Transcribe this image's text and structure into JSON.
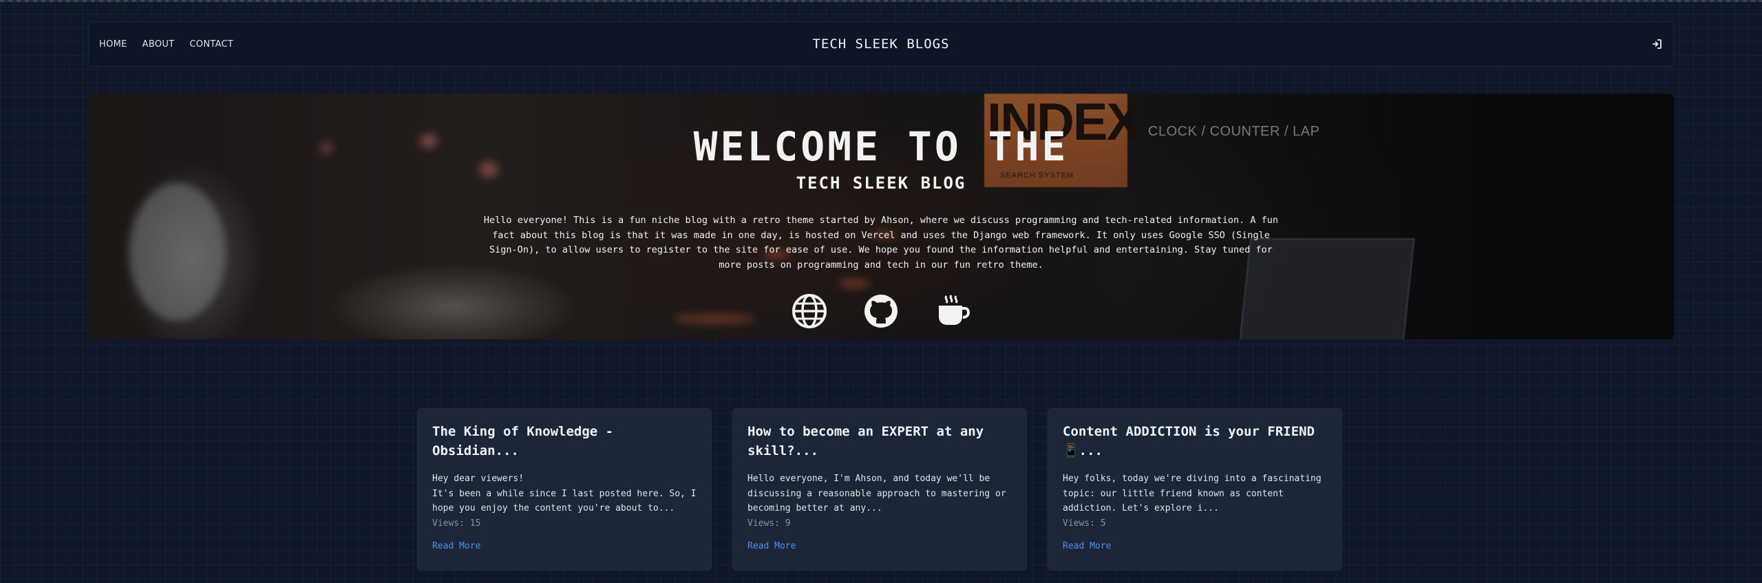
{
  "nav": {
    "links": [
      {
        "label": "HOME"
      },
      {
        "label": "ABOUT"
      },
      {
        "label": "CONTACT"
      }
    ],
    "brand": "TECH SLEEK BLOGS",
    "login_icon": "sign-in-icon"
  },
  "hero": {
    "image_text": {
      "index": "INDEX",
      "index_sub": "SEARCH SYSTEM",
      "clock": "CLOCK / COUNTER / LAP"
    },
    "title": "WELCOME TO THE",
    "subtitle": "TECH SLEEK BLOG",
    "description": "Hello everyone! This is a fun niche blog with a retro theme started by Ahson, where we discuss programming and tech-related information. A fun fact about this blog is that it was made in one day, is hosted on Vercel and uses the Django web framework. It only uses Google SSO (Single Sign-On), to allow users to register to the site for ease of use. We hope you found the information helpful and entertaining. Stay tuned for more posts on programming and tech in our fun retro theme.",
    "social_icons": [
      "globe-icon",
      "github-icon",
      "coffee-icon"
    ]
  },
  "posts": [
    {
      "title": "The King of Knowledge - Obsidian...",
      "excerpt": "Hey dear viewers!\nIt's been a while since I last posted here. So, I hope you enjoy the content you're about to...",
      "views": "Views: 15",
      "link": "Read More"
    },
    {
      "title": "How to become an EXPERT at any skill?...",
      "excerpt": "Hello everyone, I'm Ahson, and today we'll be discussing a reasonable approach to mastering or becoming better at any...",
      "views": "Views: 9",
      "link": "Read More"
    },
    {
      "title": "Content ADDICTION is your FRIEND 📱...",
      "excerpt": "Hey folks, today we're diving into a fascinating topic: our little friend known as content addiction. Let's explore i...",
      "views": "Views: 5",
      "link": "Read More"
    }
  ],
  "colors": {
    "background": "#0f1729",
    "card": "#1d2638",
    "link": "#4f8ff5"
  }
}
